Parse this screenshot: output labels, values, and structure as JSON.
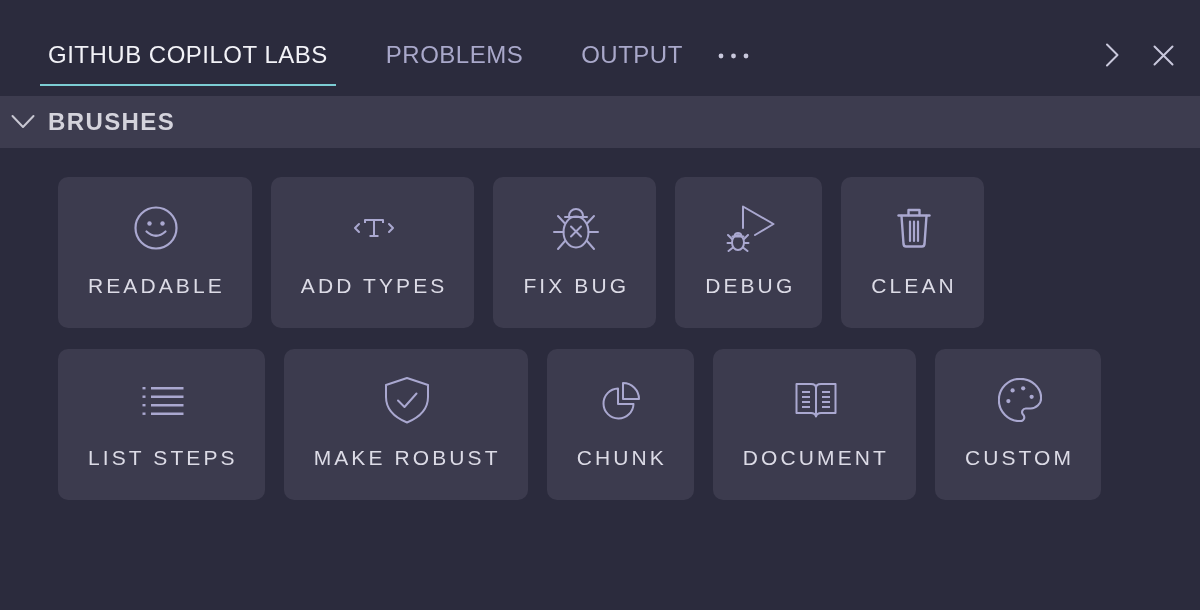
{
  "tabs": [
    {
      "label": "GITHUB COPILOT LABS",
      "selected": true
    },
    {
      "label": "PROBLEMS",
      "selected": false
    },
    {
      "label": "OUTPUT",
      "selected": false
    }
  ],
  "section": {
    "title": "BRUSHES",
    "expanded": true,
    "rows": [
      [
        {
          "label": "READABLE"
        },
        {
          "label": "ADD TYPES"
        },
        {
          "label": "FIX BUG"
        },
        {
          "label": "DEBUG"
        },
        {
          "label": "CLEAN"
        }
      ],
      [
        {
          "label": "LIST STEPS"
        },
        {
          "label": "MAKE ROBUST"
        },
        {
          "label": "CHUNK"
        },
        {
          "label": "DOCUMENT"
        },
        {
          "label": "CUSTOM"
        }
      ]
    ]
  }
}
